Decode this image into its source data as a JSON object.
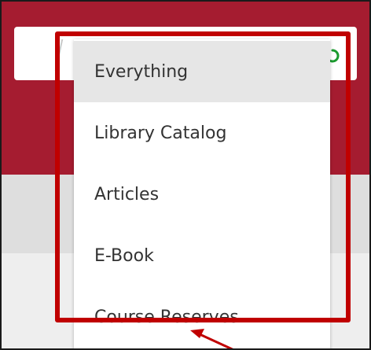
{
  "dropdown": {
    "options": [
      {
        "label": "Everything",
        "selected": true
      },
      {
        "label": "Library Catalog",
        "selected": false
      },
      {
        "label": "Articles",
        "selected": false
      },
      {
        "label": "E-Book",
        "selected": false
      },
      {
        "label": "Course Reserves",
        "selected": false
      }
    ]
  },
  "icons": {
    "refresh": "refresh-icon"
  },
  "colors": {
    "brand_red": "#a51c30",
    "highlight_red": "#c00000",
    "selected_bg": "#e6e6e6",
    "refresh_green": "#1a9a2e"
  }
}
